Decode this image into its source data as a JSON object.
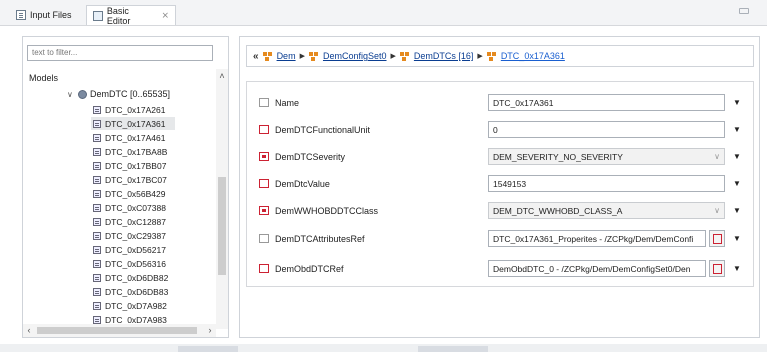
{
  "tabs": [
    {
      "label": "Input Files",
      "icon": "input-files-icon"
    },
    {
      "label": "Basic Editor",
      "icon": "editor-icon",
      "close": "⨯"
    }
  ],
  "left_panel": {
    "filter_placeholder": "text to filter...",
    "models_label": "Models",
    "root_label": "DemDTC [0..65535]",
    "items": [
      "DTC_0x17A261",
      "DTC_0x17A361",
      "DTC_0x17A461",
      "DTC_0x17BA8B",
      "DTC_0x17BB07",
      "DTC_0x17BC07",
      "DTC_0x56B429",
      "DTC_0xC07388",
      "DTC_0xC12887",
      "DTC_0xC29387",
      "DTC_0xD56217",
      "DTC_0xD56316",
      "DTC_0xD6DB82",
      "DTC_0xD6DB83",
      "DTC_0xD7A982",
      "DTC_0xD7A983"
    ],
    "selected_item": "DTC_0x17A361"
  },
  "breadcrumb": {
    "back": "«",
    "items": [
      "Dem",
      "DemConfigSet0",
      "DemDTCs [16]",
      "DTC_0x17A361"
    ]
  },
  "form_rows": [
    {
      "label": "Name",
      "value": "DTC_0x17A361",
      "kind": "text"
    },
    {
      "label": "DemDTCFunctionalUnit",
      "value": "0",
      "kind": "text"
    },
    {
      "label": "DemDTCSeverity",
      "value": "DEM_SEVERITY_NO_SEVERITY",
      "kind": "combo"
    },
    {
      "label": "DemDtcValue",
      "value": "1549153",
      "kind": "text"
    },
    {
      "label": "DemWWHOBDDTCClass",
      "value": "DEM_DTC_WWHOBD_CLASS_A",
      "kind": "combo"
    },
    {
      "label": "DemDTCAttributesRef",
      "value": "DTC_0x17A361_Properites - /ZCPkg/Dem/DemConfi",
      "kind": "ref"
    },
    {
      "label": "DemObdDTCRef",
      "value": "DemObdDTC_0 - /ZCPkg/Dem/DemConfigSet0/Den",
      "kind": "ref"
    }
  ],
  "colors": {
    "accent_link": "#0a3d91",
    "selection_bg": "#e6e8ea",
    "ref_icon": "#cc2233"
  }
}
